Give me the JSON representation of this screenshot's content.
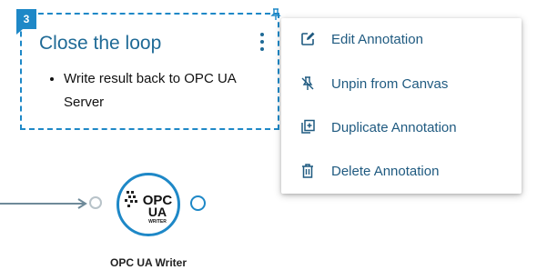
{
  "annotation": {
    "badge": "3",
    "title": "Close the loop",
    "bullets": [
      "Write result back to OPC UA Server"
    ]
  },
  "menu": {
    "items": [
      {
        "label": "Edit Annotation",
        "icon": "edit-icon"
      },
      {
        "label": "Unpin from Canvas",
        "icon": "unpin-icon"
      },
      {
        "label": "Duplicate Annotation",
        "icon": "duplicate-icon"
      },
      {
        "label": "Delete Annotation",
        "icon": "delete-icon"
      }
    ]
  },
  "node": {
    "label": "OPC UA Writer",
    "logo_text": [
      "OPC",
      "UA",
      "WRITER"
    ]
  },
  "colors": {
    "accent": "#1e88c7",
    "title": "#1f6a96",
    "menu_text": "#1f5a80"
  }
}
